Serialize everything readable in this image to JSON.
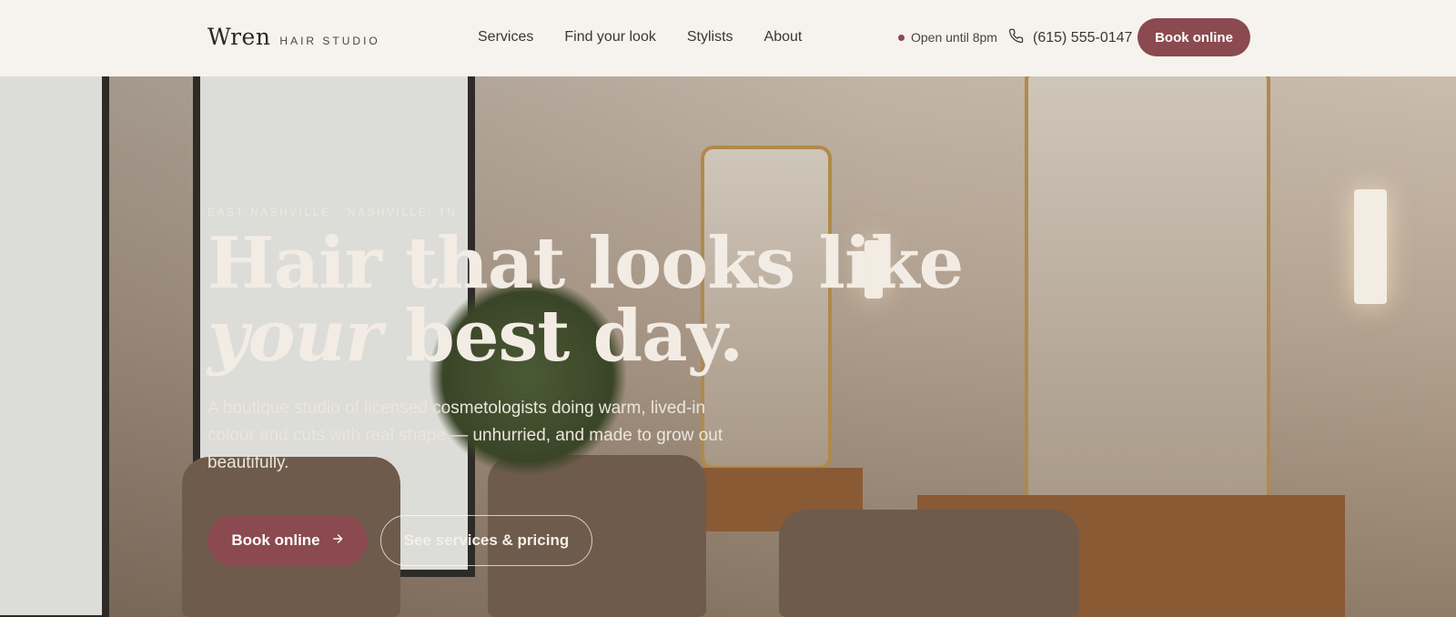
{
  "header": {
    "logo_word": "Wren",
    "logo_sub": "HAIR STUDIO",
    "nav": [
      "Services",
      "Find your look",
      "Stylists",
      "About"
    ],
    "status": "Open until 8pm",
    "phone": "(615) 555-0147",
    "cta": "Book online"
  },
  "hero": {
    "eyebrow": "EAST NASHVILLE · NASHVILLE, TN",
    "headline_line1": "Hair that looks like",
    "headline_em": "your",
    "headline_rest": " best day.",
    "lede": "A boutique studio of licensed cosmetologists doing warm, lived-in colour and cuts with real shape — unhurried, and made to grow out beautifully.",
    "primary_cta": "Book online",
    "secondary_cta": "See services & pricing"
  },
  "colors": {
    "accent": "#8b4a4f",
    "header_bg": "#f6f3ee"
  }
}
